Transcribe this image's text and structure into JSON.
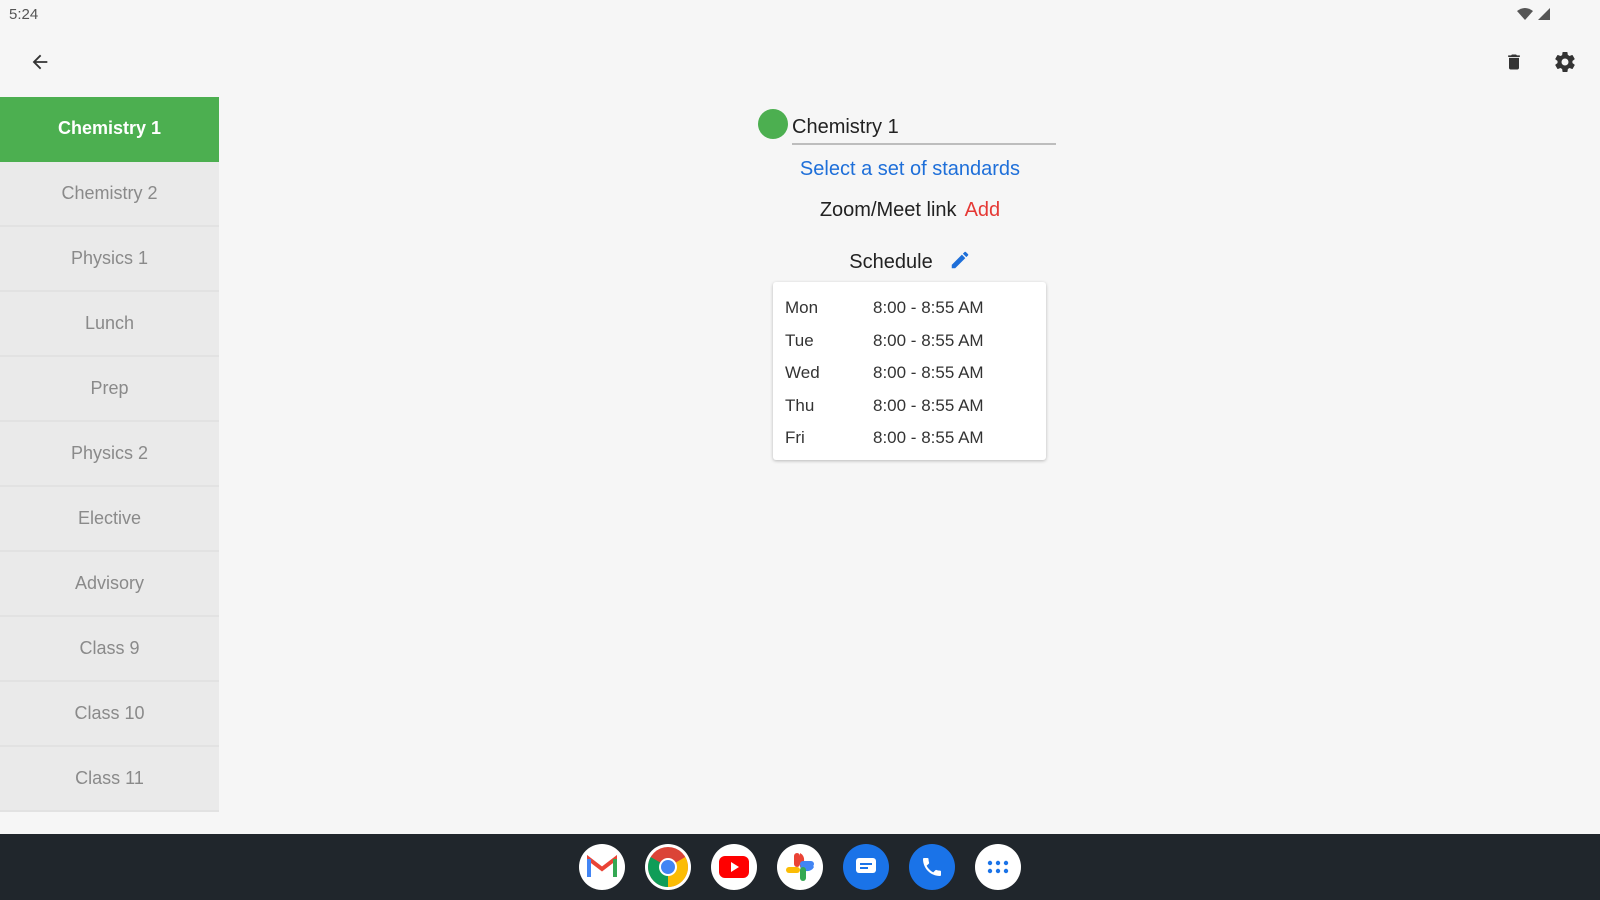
{
  "status_bar": {
    "time": "5:24",
    "icons": [
      "wifi-icon",
      "signal-icon"
    ]
  },
  "app_bar": {
    "back_icon": "back-arrow-icon",
    "actions": [
      "trash-icon",
      "gear-icon"
    ]
  },
  "sidebar": {
    "items": [
      {
        "label": "Chemistry 1",
        "active": true
      },
      {
        "label": "Chemistry 2"
      },
      {
        "label": "Physics 1"
      },
      {
        "label": "Lunch"
      },
      {
        "label": "Prep"
      },
      {
        "label": "Physics 2"
      },
      {
        "label": "Elective"
      },
      {
        "label": "Advisory"
      },
      {
        "label": "Class 9"
      },
      {
        "label": "Class 10"
      },
      {
        "label": "Class 11"
      }
    ]
  },
  "main": {
    "class_color": "#4caf50",
    "class_name": "Chemistry 1",
    "standards_link": "Select a set of standards",
    "zoom_label": "Zoom/Meet link",
    "zoom_add": "Add",
    "schedule_label": "Schedule",
    "schedule": [
      {
        "day": "Mon",
        "time": "8:00 - 8:55 AM"
      },
      {
        "day": "Tue",
        "time": "8:00 - 8:55 AM"
      },
      {
        "day": "Wed",
        "time": "8:00 - 8:55 AM"
      },
      {
        "day": "Thu",
        "time": "8:00 - 8:55 AM"
      },
      {
        "day": "Fri",
        "time": "8:00 - 8:55 AM"
      }
    ]
  },
  "taskbar": {
    "apps": [
      "gmail-icon",
      "chrome-icon",
      "youtube-icon",
      "photos-icon",
      "messages-icon",
      "phone-icon",
      "app-drawer-icon"
    ]
  },
  "colors": {
    "accent_green": "#4caf50",
    "link_blue": "#1e6fd9",
    "add_red": "#e53935",
    "taskbar": "#20262c"
  }
}
